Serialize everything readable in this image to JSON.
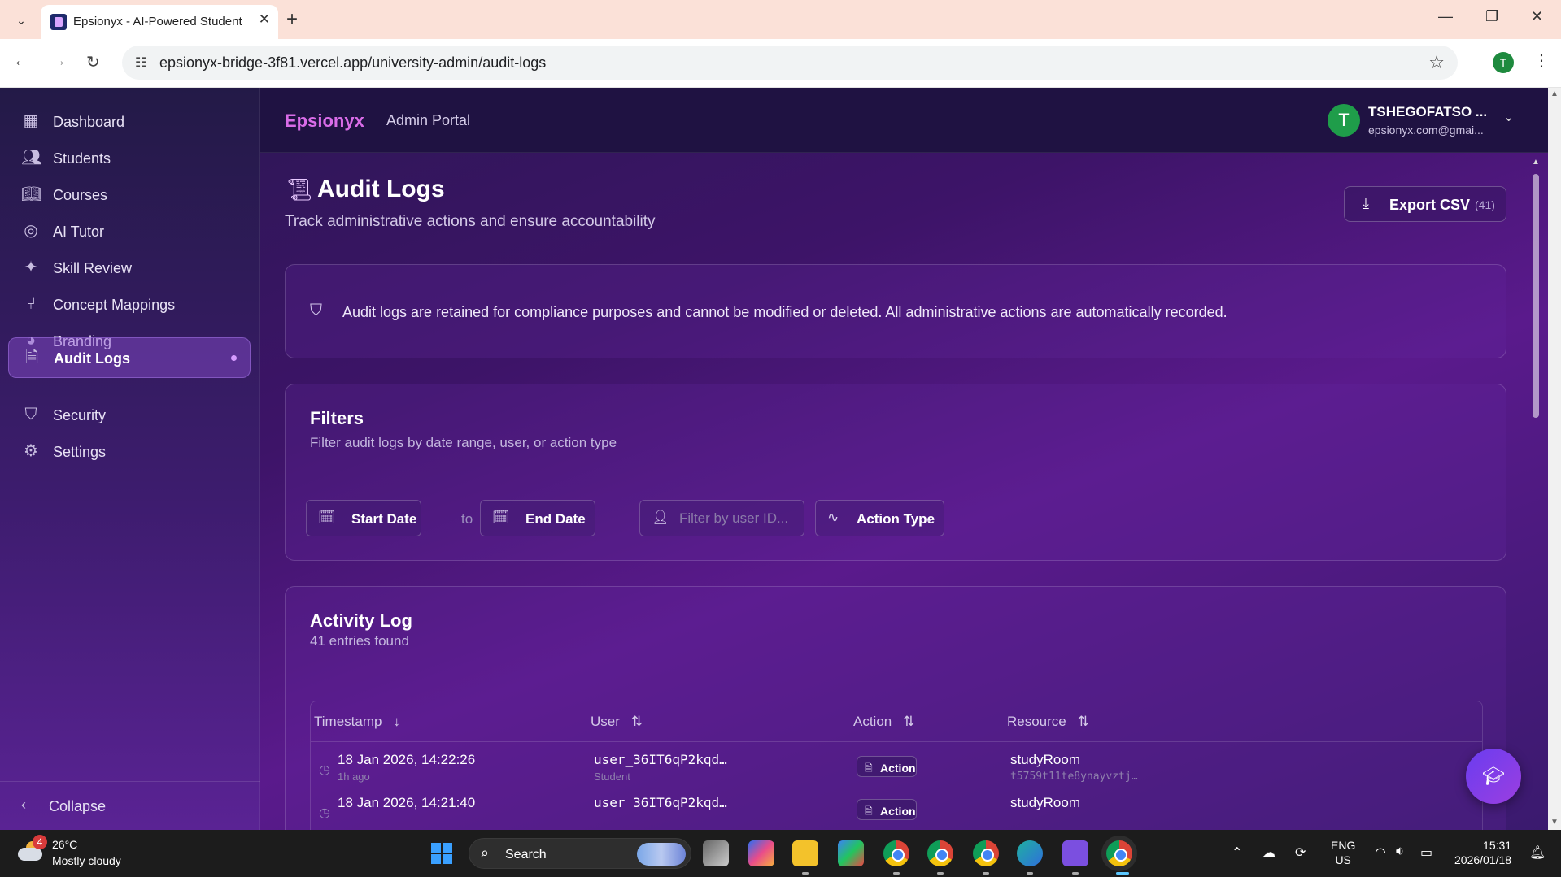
{
  "browser": {
    "tab_title": "Epsionyx - AI-Powered Student",
    "url": "epsionyx-bridge-3f81.vercel.app/university-admin/audit-logs",
    "profile_initial": "T"
  },
  "sidebar": {
    "items": [
      {
        "label": "Dashboard",
        "icon": "dashboard-icon"
      },
      {
        "label": "Students",
        "icon": "users-icon"
      },
      {
        "label": "Courses",
        "icon": "book-icon"
      },
      {
        "label": "AI Tutor",
        "icon": "brain-icon"
      },
      {
        "label": "Skill Review",
        "icon": "sparkles-icon"
      },
      {
        "label": "Concept Mappings",
        "icon": "git-branch-icon"
      },
      {
        "label": "Branding",
        "icon": "palette-icon"
      },
      {
        "label": "Audit Logs",
        "icon": "file-text-icon",
        "active": true
      },
      {
        "label": "Security",
        "icon": "shield-icon"
      },
      {
        "label": "Settings",
        "icon": "gear-icon"
      }
    ],
    "collapse_label": "Collapse"
  },
  "header": {
    "brand": "Epsionyx",
    "subtitle": "Admin Portal",
    "user_initial": "T",
    "user_name": "TSHEGOFATSO ...",
    "user_email": "epsionyx.com@gmai..."
  },
  "page": {
    "title": "Audit Logs",
    "subtitle": "Track administrative actions and ensure accountability",
    "export_label": "Export CSV",
    "export_count": "(41)"
  },
  "notice": {
    "text": "Audit logs are retained for compliance purposes and cannot be modified or deleted. All administrative actions are automatically recorded."
  },
  "filters": {
    "title": "Filters",
    "subtitle": "Filter audit logs by date range, user, or action type",
    "start_date": "Start Date",
    "to": "to",
    "end_date": "End Date",
    "user_placeholder": "Filter by user ID...",
    "action_type": "Action Type"
  },
  "activity": {
    "title": "Activity Log",
    "count": "41 entries found",
    "columns": [
      "Timestamp",
      "User",
      "Action",
      "Resource"
    ],
    "rows": [
      {
        "timestamp": "18 Jan 2026, 14:22:26",
        "ago": "1h ago",
        "user": "user_36IT6qP2kqd…",
        "role": "Student",
        "action": "Action",
        "resource": "studyRoom",
        "resource_id": "t5759t11te8ynayvztj…"
      },
      {
        "timestamp": "18 Jan 2026, 14:21:40",
        "ago": "",
        "user": "user_36IT6qP2kqd…",
        "role": "",
        "action": "Action",
        "resource": "studyRoom",
        "resource_id": ""
      }
    ]
  },
  "taskbar": {
    "weather_badge": "4",
    "temperature": "26°C",
    "condition": "Mostly cloudy",
    "search_label": "Search",
    "lang_top": "ENG",
    "lang_bottom": "US",
    "time": "15:31",
    "date": "2026/01/18"
  }
}
